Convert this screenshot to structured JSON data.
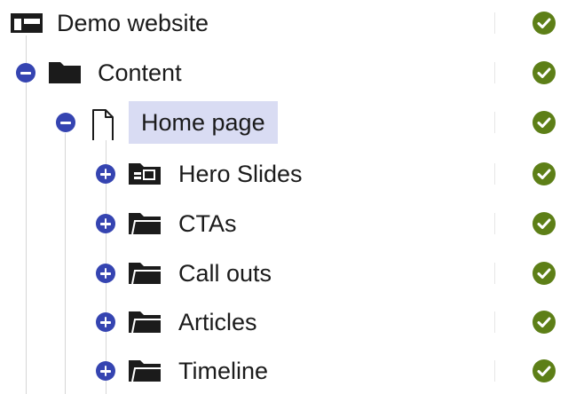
{
  "tree": {
    "root": {
      "label": "Demo website",
      "icon": "website-layout-icon"
    },
    "content": {
      "label": "Content",
      "icon": "folder-icon"
    },
    "home": {
      "label": "Home page",
      "icon": "document-icon"
    },
    "children": [
      {
        "label": "Hero Slides",
        "icon": "slides-icon"
      },
      {
        "label": "CTAs",
        "icon": "folder-icon"
      },
      {
        "label": "Call outs",
        "icon": "folder-icon"
      },
      {
        "label": "Articles",
        "icon": "folder-icon"
      },
      {
        "label": "Timeline",
        "icon": "folder-icon"
      }
    ]
  },
  "colors": {
    "toggle": "#3544b1",
    "selection": "#d9dcf3",
    "status_ok": "#5d7f17",
    "tree_line": "#d6d6d6"
  }
}
